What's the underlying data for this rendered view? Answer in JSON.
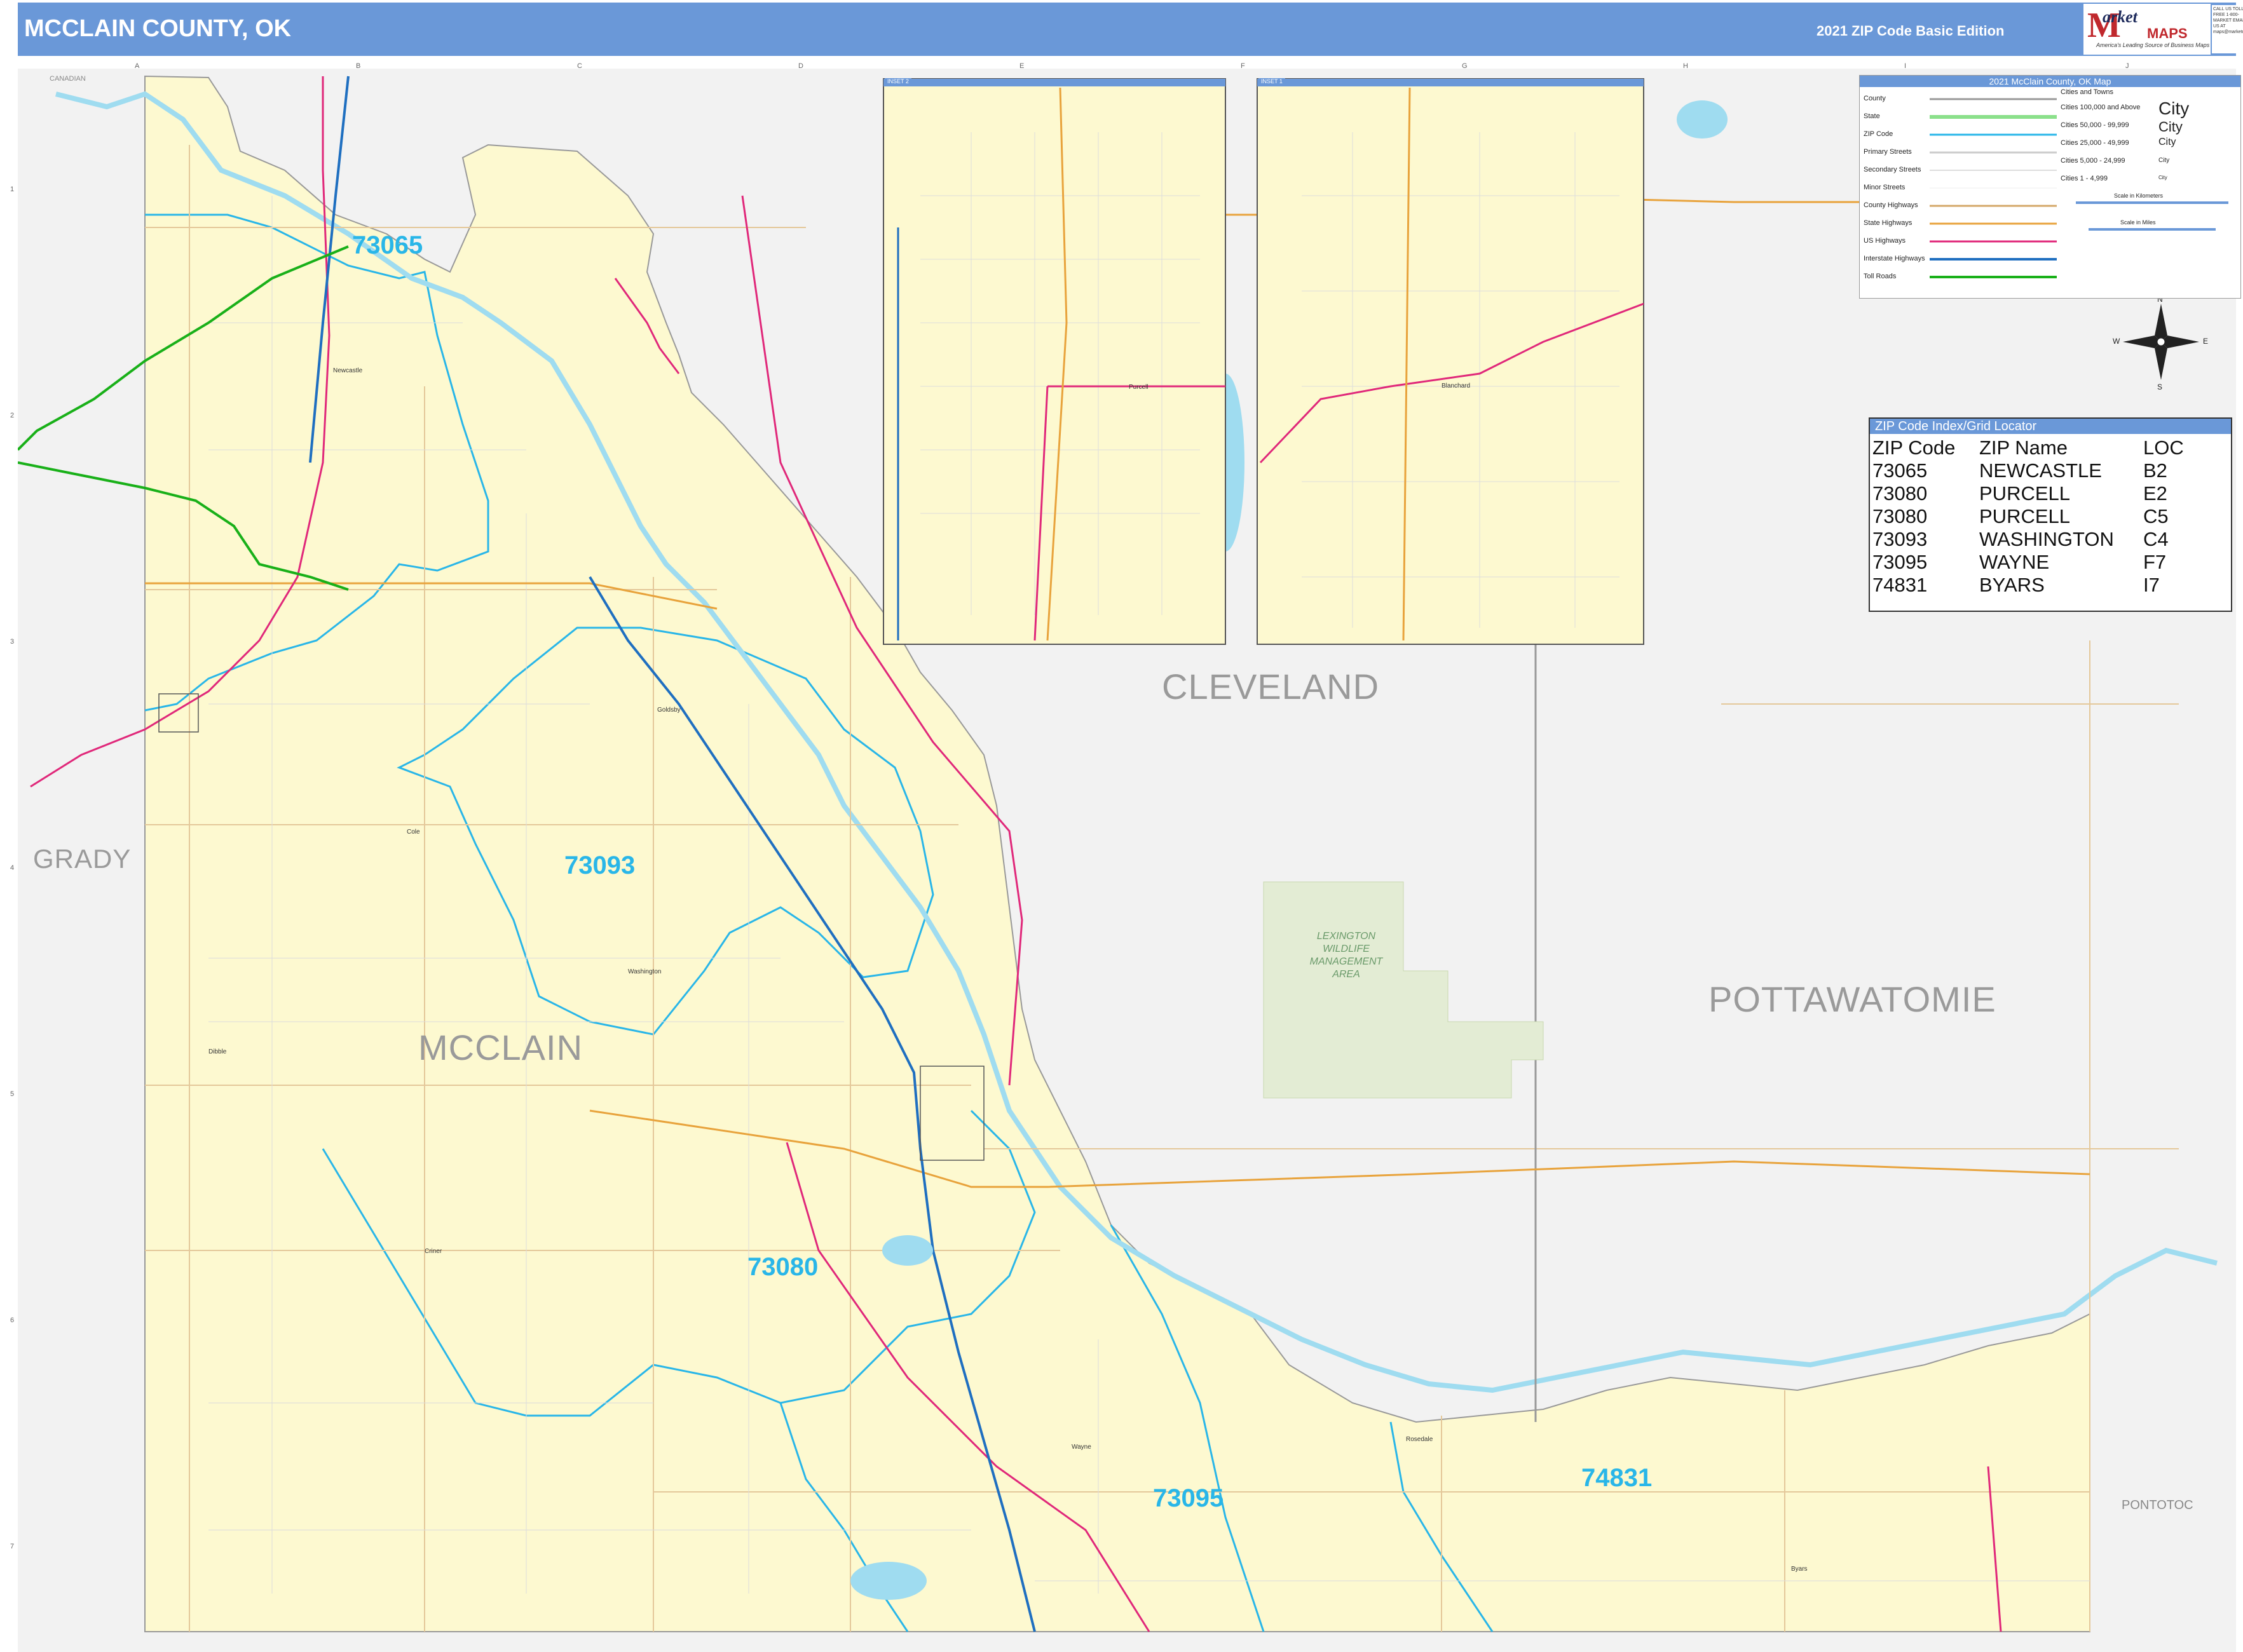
{
  "header": {
    "title": "MCCLAIN COUNTY, OK",
    "edition": "2021 ZIP Code Basic Edition",
    "logo_m": "M",
    "logo_market": "arket",
    "logo_maps": "MAPS",
    "logo_tagline": "America's Leading Source of Business Maps",
    "logo_slogan": "On Target, On Time",
    "contact": "CALL US TOLL FREE 1-800-MARKET EMAIL US AT maps@marketmaps.com"
  },
  "legend": {
    "title": "2021 McClain County, OK Map",
    "line_items": [
      "County",
      "State",
      "ZIP Code",
      "Primary Streets",
      "Secondary Streets",
      "Minor Streets",
      "County Highways",
      "State Highways",
      "US Highways",
      "Interstate Highways",
      "Toll Roads"
    ],
    "cities_header": "Cities and Towns",
    "city_classes": [
      {
        "range": "Cities 100,000 and Above",
        "sample": "City"
      },
      {
        "range": "Cities 50,000 - 99,999",
        "sample": "City"
      },
      {
        "range": "Cities 25,000 - 49,999",
        "sample": "City"
      },
      {
        "range": "Cities 5,000 - 24,999",
        "sample": "City"
      },
      {
        "range": "Cities 1 - 4,999",
        "sample": "City"
      }
    ],
    "scale_km": "Scale in Kilometers",
    "scale_mi": "Scale in Miles",
    "colors": {
      "county": "#999999",
      "state": "#8be08b",
      "zip": "#29b6e8",
      "primary": "#cccccc",
      "county_hwy": "#d4a86a",
      "state_hwy": "#e8a33c",
      "us_hwy": "#e0287a",
      "interstate": "#1f6fc0",
      "toll": "#19b019"
    }
  },
  "zip_index": {
    "title": "ZIP Code Index/Grid Locator",
    "columns": [
      "ZIP Code",
      "ZIP Name",
      "LOC"
    ],
    "rows": [
      [
        "73065",
        "NEWCASTLE",
        "B2"
      ],
      [
        "73080",
        "PURCELL",
        "E2"
      ],
      [
        "73080",
        "PURCELL",
        "C5"
      ],
      [
        "73093",
        "WASHINGTON",
        "C4"
      ],
      [
        "73095",
        "WAYNE",
        "F7"
      ],
      [
        "74831",
        "BYARS",
        "I7"
      ]
    ]
  },
  "counties": {
    "mcclain": "MCCLAIN",
    "cleveland": "CLEVELAND",
    "pottawatomie": "POTTAWATOMIE",
    "grady": "GRADY",
    "pontotoc": "PONTOTOC",
    "canadian": "CANADIAN"
  },
  "zips": {
    "z73065": "73065",
    "z73093": "73093",
    "z73080": "73080",
    "z73095": "73095",
    "z74831": "74831"
  },
  "towns": {
    "newcastle": "Newcastle",
    "washington": "Washington",
    "goldsby": "Goldsby",
    "cole": "Cole",
    "dibble": "Dibble",
    "criner": "Criner",
    "wayne": "Wayne",
    "rosedale": "Rosedale",
    "byars": "Byars",
    "purcell": "Purcell",
    "blanchard": "Blanchard"
  },
  "park": {
    "line1": "LEXINGTON",
    "line2": "WILDLIFE",
    "line3": "MANAGEMENT",
    "line4": "AREA"
  },
  "insets": {
    "inset1": "INSET 1",
    "inset2": "INSET 2"
  },
  "grid": {
    "columns": [
      "A",
      "B",
      "C",
      "D",
      "E",
      "F",
      "G",
      "H",
      "I",
      "J"
    ],
    "rows": [
      "1",
      "2",
      "3",
      "4",
      "5",
      "6",
      "7"
    ]
  },
  "compass": {
    "n": "N",
    "s": "S",
    "e": "E",
    "w": "W"
  }
}
